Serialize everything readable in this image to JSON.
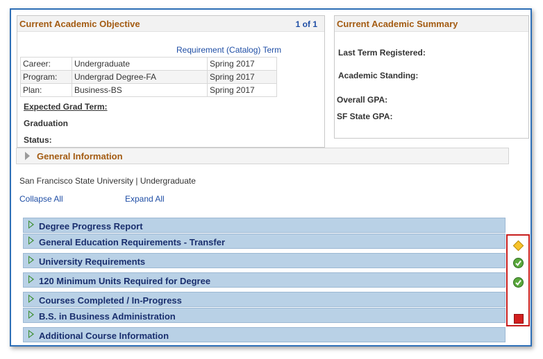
{
  "objective": {
    "title": "Current Academic Objective",
    "pager": "1 of 1",
    "column_header": "Requirement (Catalog) Term",
    "rows": [
      {
        "label": "Career:",
        "value": "Undergraduate",
        "term": "Spring 2017"
      },
      {
        "label": "Program:",
        "value": "Undergrad Degree-FA",
        "term": "Spring 2017"
      },
      {
        "label": "Plan:",
        "value": "Business-BS",
        "term": "Spring 2017"
      }
    ],
    "expected_grad_term": "Expected Grad Term:",
    "graduation": "Graduation",
    "status": "Status:"
  },
  "summary": {
    "title": "Current Academic Summary",
    "last_term": "Last Term Registered:",
    "standing": "Academic Standing:",
    "overall_gpa": "Overall GPA:",
    "sf_gpa": "SF State GPA:"
  },
  "general_info": {
    "label": "General Information"
  },
  "institution_line": "San Francisco State University | Undergraduate",
  "links": {
    "collapse_all": "Collapse All",
    "expand_all": "Expand All"
  },
  "requirements": [
    {
      "label": "Degree Progress Report",
      "status": ""
    },
    {
      "label": "General Education Requirements - Transfer",
      "status": "in-progress"
    },
    {
      "label": "University Requirements",
      "status": "satisfied"
    },
    {
      "label": "120 Minimum Units Required for Degree",
      "status": "satisfied"
    },
    {
      "label": "Courses Completed / In-Progress",
      "status": ""
    },
    {
      "label": "B.S. in Business Administration",
      "status": "not-satisfied"
    },
    {
      "label": "Additional Course Information",
      "status": ""
    }
  ],
  "colors": {
    "accent_orange": "#a35b12",
    "link_blue": "#1f4ea5",
    "bar_blue": "#b9d1e6",
    "highlight_red": "#c71f1f"
  },
  "icons": {
    "in_progress": "yellow-diamond-icon",
    "satisfied": "green-check-icon",
    "not_satisfied": "red-square-icon"
  }
}
